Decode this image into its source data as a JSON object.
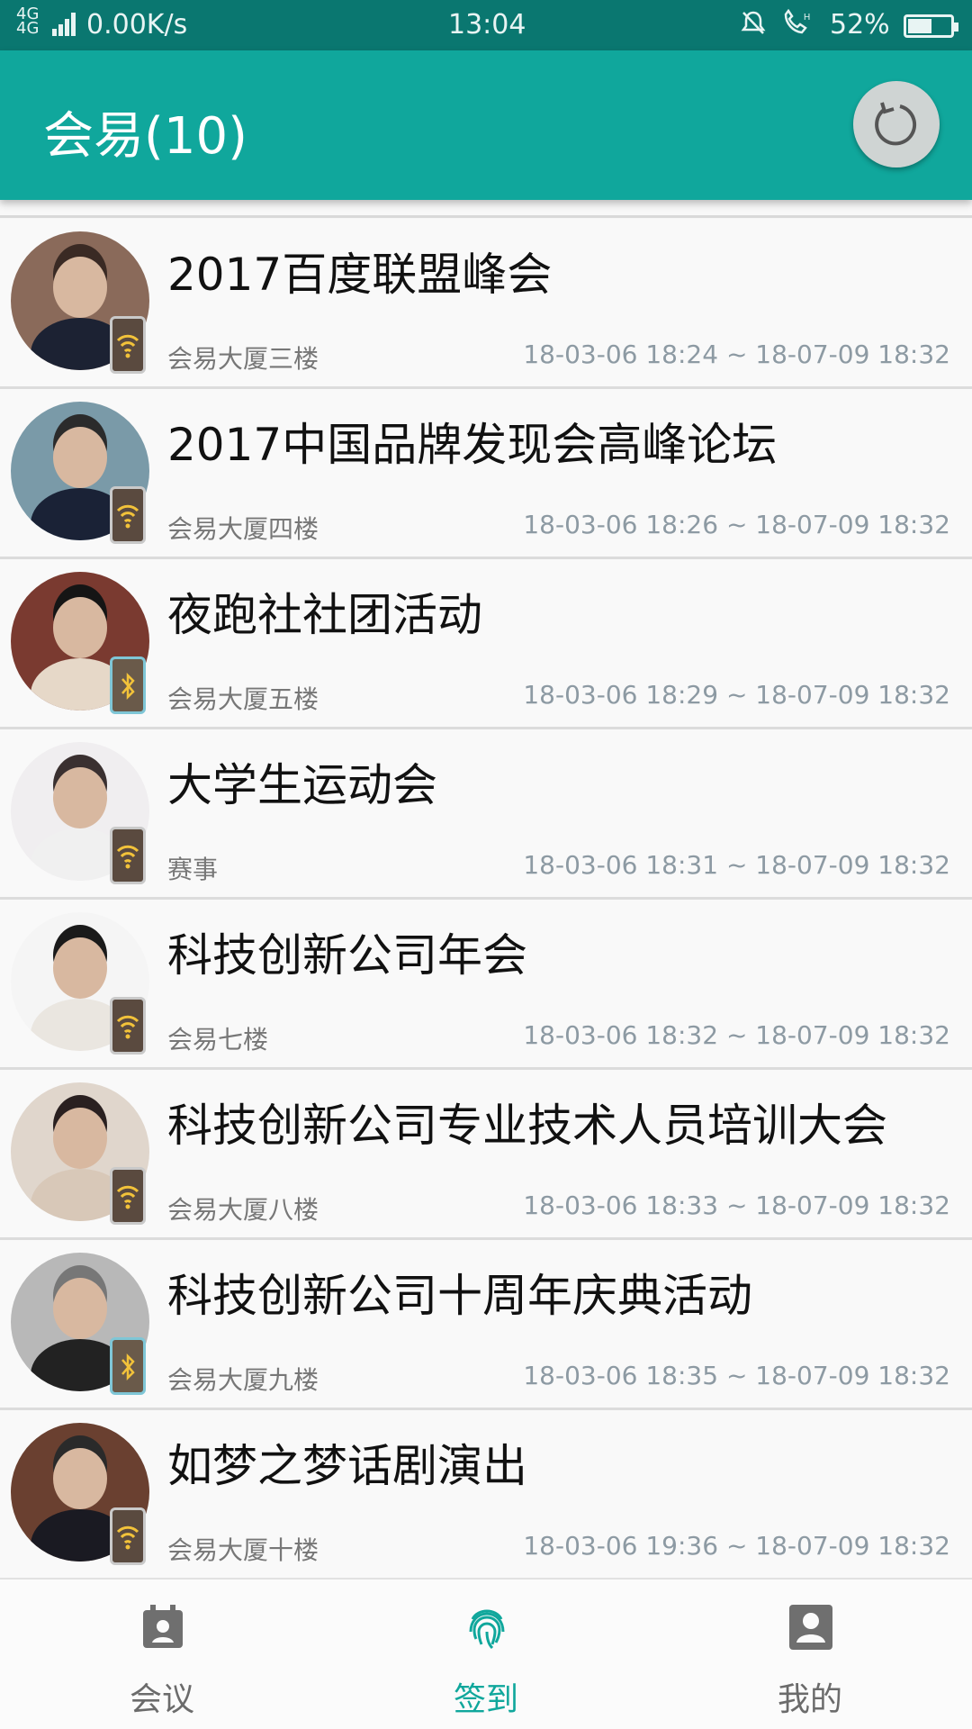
{
  "status_bar": {
    "signal": "4G 4G",
    "network_speed": "0.00K/s",
    "time": "13:04",
    "battery_percent": "52%",
    "battery_level": 0.52,
    "icons": [
      "signal-icon",
      "mute-icon",
      "hd-call-icon",
      "battery-icon"
    ]
  },
  "app_bar": {
    "title": "会易(10)",
    "refresh_icon": "refresh-icon"
  },
  "meetings": [
    {
      "title": "2017百度联盟峰会",
      "location": "会易大厦三楼",
      "time": "18-03-06 18:24 ~ 18-07-09 18:32",
      "sign_type": "wifi"
    },
    {
      "title": "2017中国品牌发现会高峰论坛",
      "location": "会易大厦四楼",
      "time": "18-03-06 18:26 ~ 18-07-09 18:32",
      "sign_type": "wifi"
    },
    {
      "title": "夜跑社社团活动",
      "location": "会易大厦五楼",
      "time": "18-03-06 18:29 ~ 18-07-09 18:32",
      "sign_type": "bluetooth"
    },
    {
      "title": "大学生运动会",
      "location": "赛事",
      "time": "18-03-06 18:31 ~ 18-07-09 18:32",
      "sign_type": "wifi"
    },
    {
      "title": "科技创新公司年会",
      "location": "会易七楼",
      "time": "18-03-06 18:32 ~ 18-07-09 18:32",
      "sign_type": "wifi"
    },
    {
      "title": "科技创新公司专业技术人员培训大会",
      "location": "会易大厦八楼",
      "time": "18-03-06 18:33 ~ 18-07-09 18:32",
      "sign_type": "wifi"
    },
    {
      "title": "科技创新公司十周年庆典活动",
      "location": "会易大厦九楼",
      "time": "18-03-06 18:35 ~ 18-07-09 18:32",
      "sign_type": "bluetooth"
    },
    {
      "title": "如梦之梦话剧演出",
      "location": "会易大厦十楼",
      "time": "18-03-06 19:36 ~ 18-07-09 18:32",
      "sign_type": "wifi"
    }
  ],
  "bottom_nav": {
    "tabs": [
      {
        "label": "会议",
        "icon": "calendar-icon",
        "active": false
      },
      {
        "label": "签到",
        "icon": "fingerprint-icon",
        "active": true
      },
      {
        "label": "我的",
        "icon": "profile-icon",
        "active": false
      }
    ]
  },
  "colors": {
    "status_bar": "#0a7770",
    "app_bar": "#10a79c",
    "accent": "#10a79c"
  }
}
